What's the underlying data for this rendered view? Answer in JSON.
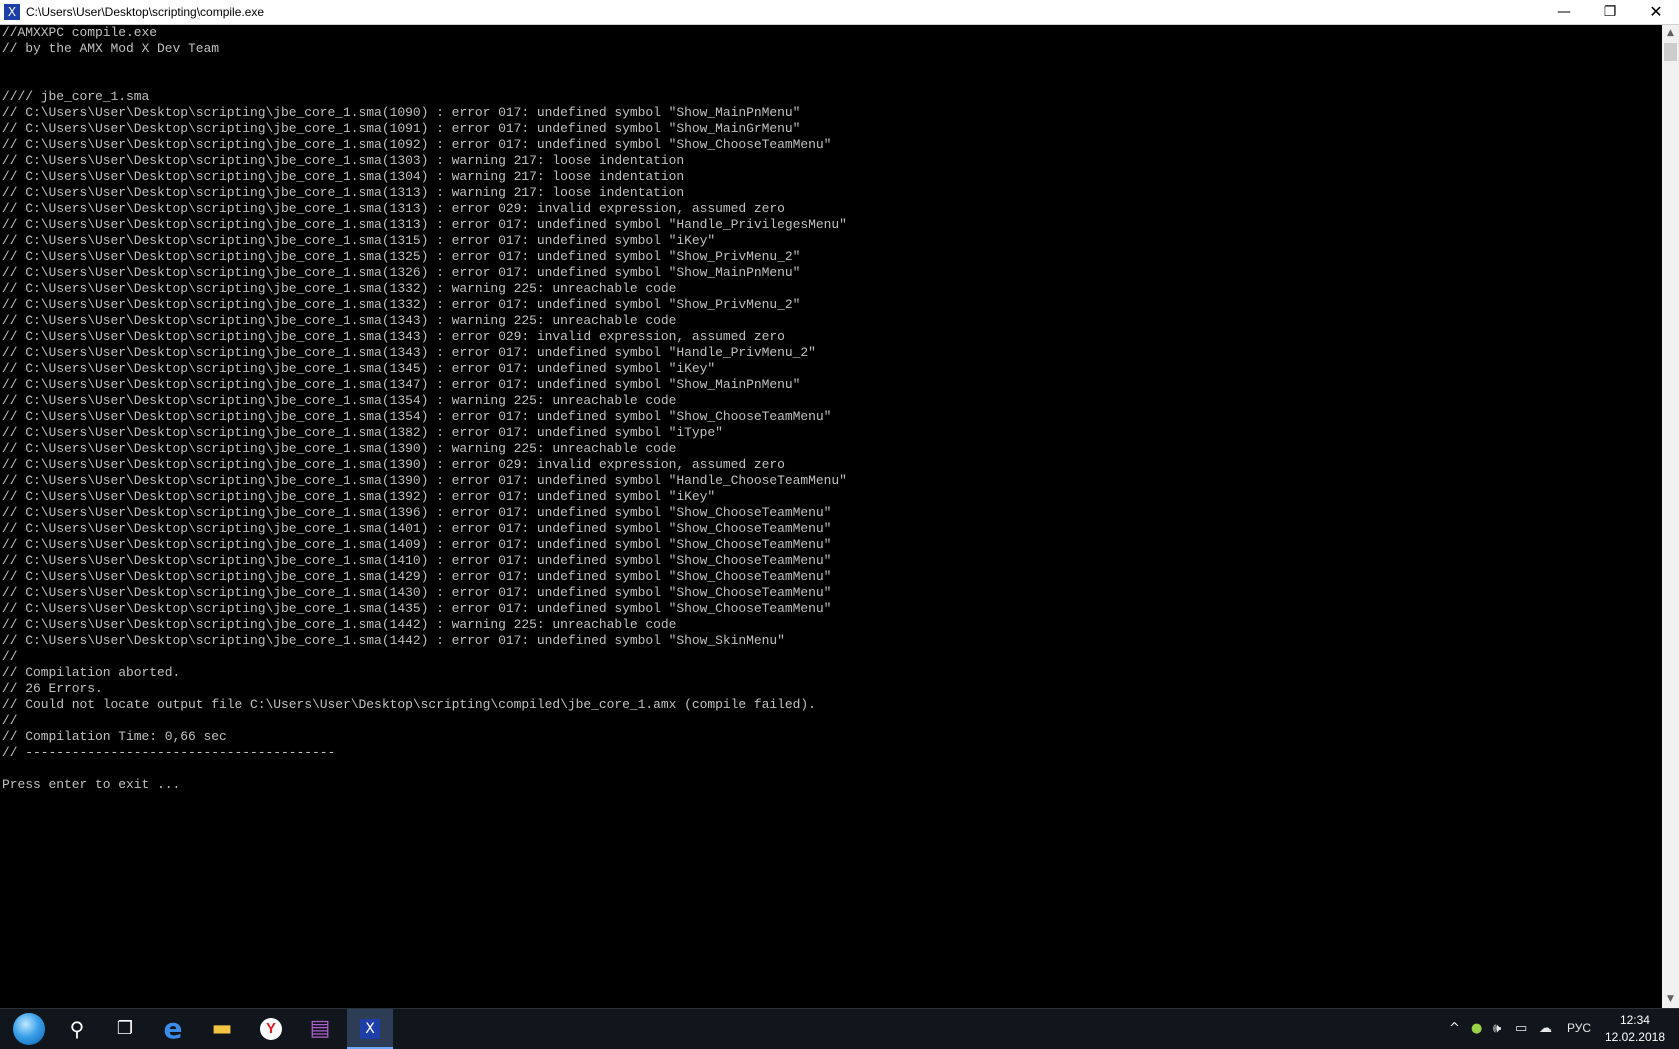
{
  "window": {
    "title": "C:\\Users\\User\\Desktop\\scripting\\compile.exe",
    "app_icon_glyph": "X",
    "minimize_glyph": "—",
    "maximize_glyph": "❐",
    "close_glyph": "✕"
  },
  "console": {
    "lines": [
      "//AMXXPC compile.exe",
      "// by the AMX Mod X Dev Team",
      "",
      "",
      "//// jbe_core_1.sma",
      "// C:\\Users\\User\\Desktop\\scripting\\jbe_core_1.sma(1090) : error 017: undefined symbol \"Show_MainPnMenu\"",
      "// C:\\Users\\User\\Desktop\\scripting\\jbe_core_1.sma(1091) : error 017: undefined symbol \"Show_MainGrMenu\"",
      "// C:\\Users\\User\\Desktop\\scripting\\jbe_core_1.sma(1092) : error 017: undefined symbol \"Show_ChooseTeamMenu\"",
      "// C:\\Users\\User\\Desktop\\scripting\\jbe_core_1.sma(1303) : warning 217: loose indentation",
      "// C:\\Users\\User\\Desktop\\scripting\\jbe_core_1.sma(1304) : warning 217: loose indentation",
      "// C:\\Users\\User\\Desktop\\scripting\\jbe_core_1.sma(1313) : warning 217: loose indentation",
      "// C:\\Users\\User\\Desktop\\scripting\\jbe_core_1.sma(1313) : error 029: invalid expression, assumed zero",
      "// C:\\Users\\User\\Desktop\\scripting\\jbe_core_1.sma(1313) : error 017: undefined symbol \"Handle_PrivilegesMenu\"",
      "// C:\\Users\\User\\Desktop\\scripting\\jbe_core_1.sma(1315) : error 017: undefined symbol \"iKey\"",
      "// C:\\Users\\User\\Desktop\\scripting\\jbe_core_1.sma(1325) : error 017: undefined symbol \"Show_PrivMenu_2\"",
      "// C:\\Users\\User\\Desktop\\scripting\\jbe_core_1.sma(1326) : error 017: undefined symbol \"Show_MainPnMenu\"",
      "// C:\\Users\\User\\Desktop\\scripting\\jbe_core_1.sma(1332) : warning 225: unreachable code",
      "// C:\\Users\\User\\Desktop\\scripting\\jbe_core_1.sma(1332) : error 017: undefined symbol \"Show_PrivMenu_2\"",
      "// C:\\Users\\User\\Desktop\\scripting\\jbe_core_1.sma(1343) : warning 225: unreachable code",
      "// C:\\Users\\User\\Desktop\\scripting\\jbe_core_1.sma(1343) : error 029: invalid expression, assumed zero",
      "// C:\\Users\\User\\Desktop\\scripting\\jbe_core_1.sma(1343) : error 017: undefined symbol \"Handle_PrivMenu_2\"",
      "// C:\\Users\\User\\Desktop\\scripting\\jbe_core_1.sma(1345) : error 017: undefined symbol \"iKey\"",
      "// C:\\Users\\User\\Desktop\\scripting\\jbe_core_1.sma(1347) : error 017: undefined symbol \"Show_MainPnMenu\"",
      "// C:\\Users\\User\\Desktop\\scripting\\jbe_core_1.sma(1354) : warning 225: unreachable code",
      "// C:\\Users\\User\\Desktop\\scripting\\jbe_core_1.sma(1354) : error 017: undefined symbol \"Show_ChooseTeamMenu\"",
      "// C:\\Users\\User\\Desktop\\scripting\\jbe_core_1.sma(1382) : error 017: undefined symbol \"iType\"",
      "// C:\\Users\\User\\Desktop\\scripting\\jbe_core_1.sma(1390) : warning 225: unreachable code",
      "// C:\\Users\\User\\Desktop\\scripting\\jbe_core_1.sma(1390) : error 029: invalid expression, assumed zero",
      "// C:\\Users\\User\\Desktop\\scripting\\jbe_core_1.sma(1390) : error 017: undefined symbol \"Handle_ChooseTeamMenu\"",
      "// C:\\Users\\User\\Desktop\\scripting\\jbe_core_1.sma(1392) : error 017: undefined symbol \"iKey\"",
      "// C:\\Users\\User\\Desktop\\scripting\\jbe_core_1.sma(1396) : error 017: undefined symbol \"Show_ChooseTeamMenu\"",
      "// C:\\Users\\User\\Desktop\\scripting\\jbe_core_1.sma(1401) : error 017: undefined symbol \"Show_ChooseTeamMenu\"",
      "// C:\\Users\\User\\Desktop\\scripting\\jbe_core_1.sma(1409) : error 017: undefined symbol \"Show_ChooseTeamMenu\"",
      "// C:\\Users\\User\\Desktop\\scripting\\jbe_core_1.sma(1410) : error 017: undefined symbol \"Show_ChooseTeamMenu\"",
      "// C:\\Users\\User\\Desktop\\scripting\\jbe_core_1.sma(1429) : error 017: undefined symbol \"Show_ChooseTeamMenu\"",
      "// C:\\Users\\User\\Desktop\\scripting\\jbe_core_1.sma(1430) : error 017: undefined symbol \"Show_ChooseTeamMenu\"",
      "// C:\\Users\\User\\Desktop\\scripting\\jbe_core_1.sma(1435) : error 017: undefined symbol \"Show_ChooseTeamMenu\"",
      "// C:\\Users\\User\\Desktop\\scripting\\jbe_core_1.sma(1442) : warning 225: unreachable code",
      "// C:\\Users\\User\\Desktop\\scripting\\jbe_core_1.sma(1442) : error 017: undefined symbol \"Show_SkinMenu\"",
      "//",
      "// Compilation aborted.",
      "// 26 Errors.",
      "// Could not locate output file C:\\Users\\User\\Desktop\\scripting\\compiled\\jbe_core_1.amx (compile failed).",
      "//",
      "// Compilation Time: 0,66 sec",
      "// ----------------------------------------",
      "",
      "Press enter to exit ..."
    ]
  },
  "scrollbar": {
    "up_glyph": "▲",
    "down_glyph": "▼"
  },
  "taskbar": {
    "search_glyph": "⚲",
    "taskview_glyph": "❐",
    "edge_glyph": "e",
    "explorer_glyph": "▬",
    "yandex_glyph": "Y",
    "winrar_glyph": "▤",
    "compile_glyph": "X",
    "tray": {
      "chevron_glyph": "^",
      "network1_glyph": "●",
      "volume_glyph": "🕪",
      "network2_glyph": "▭",
      "cloud_glyph": "☁",
      "language": "РУС"
    },
    "clock": {
      "time": "12:34",
      "date": "12.02.2018"
    }
  },
  "colors": {
    "console_bg": "#000000",
    "console_text": "#c0c0c0",
    "taskbar_bg": "#10161c",
    "titlebar_bg": "#ffffff"
  }
}
